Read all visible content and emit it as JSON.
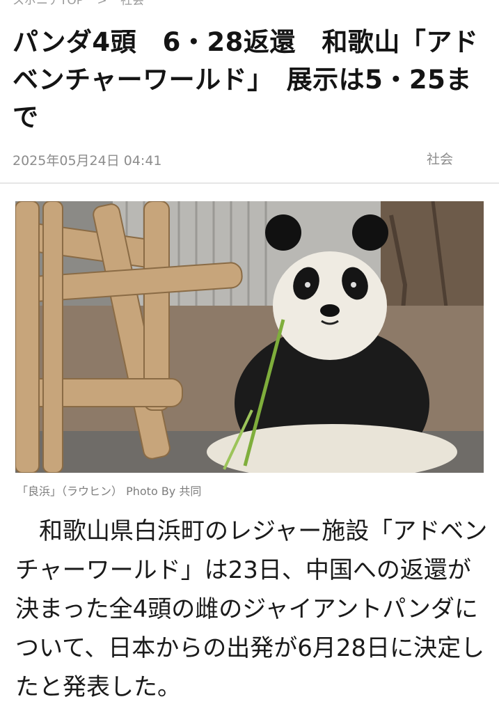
{
  "breadcrumb": {
    "home": "スポニチTOP",
    "separator": ">",
    "section": "社会"
  },
  "article": {
    "title": "パンダ4頭　6・28返還　和歌山「アドベンチャーワールド」　展示は5・25まで",
    "date": "2025年05月24日 04:41",
    "category": "社会",
    "photo_caption": "「良浜」（ラウヒン） Photo By 共同",
    "body": "和歌山県白浜町のレジャー施設「アドベンチャーワールド」は23日、中国への返還が決まった全4頭の雌のジャイアントパンダについて、日本からの出発が6月28日に決定したと発表した。"
  },
  "icons": {
    "zoom": "zoom-in-icon"
  }
}
